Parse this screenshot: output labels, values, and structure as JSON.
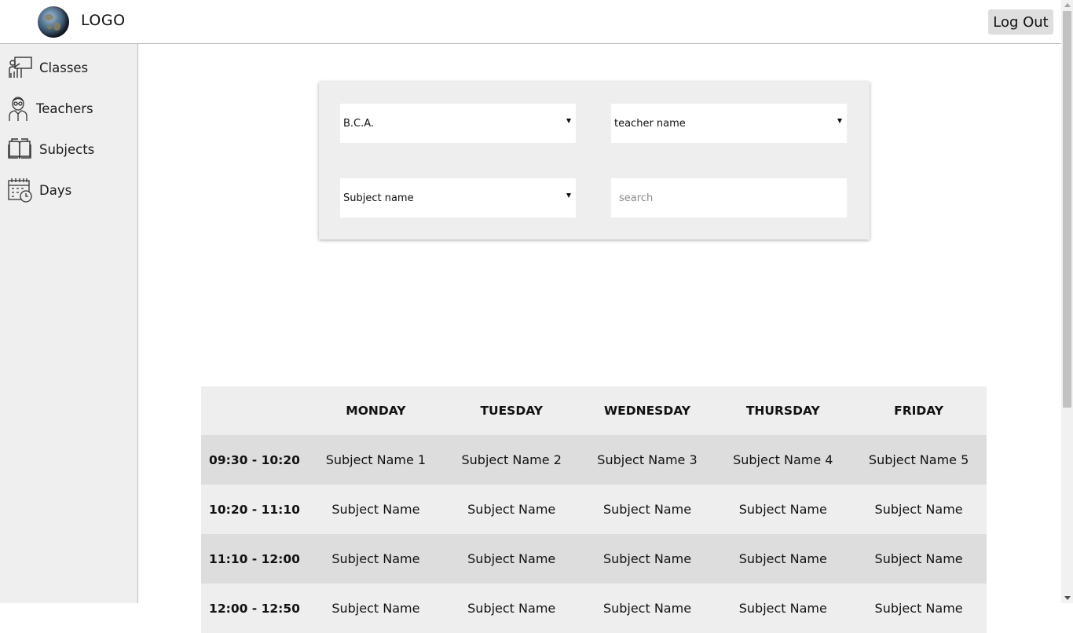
{
  "header": {
    "logo_text": "LOGO",
    "logout_label": "Log Out"
  },
  "sidebar": {
    "items": [
      {
        "label": "Classes",
        "icon": "classroom-icon"
      },
      {
        "label": "Teachers",
        "icon": "teacher-icon"
      },
      {
        "label": "Subjects",
        "icon": "book-icon"
      },
      {
        "label": "Days",
        "icon": "calendar-clock-icon"
      }
    ]
  },
  "filters": {
    "class_select": {
      "value": "B.C.A."
    },
    "teacher_select": {
      "value": "teacher name"
    },
    "subject_select": {
      "value": "Subject name"
    },
    "search": {
      "placeholder": "search",
      "value": ""
    }
  },
  "timetable": {
    "days": [
      "MONDAY",
      "TUESDAY",
      "WEDNESDAY",
      "THURSDAY",
      "FRIDAY"
    ],
    "rows": [
      {
        "time": "09:30 - 10:20",
        "cells": [
          "Subject Name 1",
          "Subject Name 2",
          "Subject Name 3",
          "Subject Name 4",
          "Subject Name 5"
        ]
      },
      {
        "time": "10:20 - 11:10",
        "cells": [
          "Subject Name",
          "Subject Name",
          "Subject Name",
          "Subject Name",
          "Subject Name"
        ]
      },
      {
        "time": "11:10 - 12:00",
        "cells": [
          "Subject Name",
          "Subject Name",
          "Subject Name",
          "Subject Name",
          "Subject Name"
        ]
      },
      {
        "time": "12:00 - 12:50",
        "cells": [
          "Subject Name",
          "Subject Name",
          "Subject Name",
          "Subject Name",
          "Subject Name"
        ]
      }
    ]
  },
  "colors": {
    "sidebar_bg": "#efefef",
    "panel_bg": "#eeeeee",
    "row_dark": "#dddddd",
    "row_light": "#eeeeee",
    "button_bg": "#dedede"
  }
}
